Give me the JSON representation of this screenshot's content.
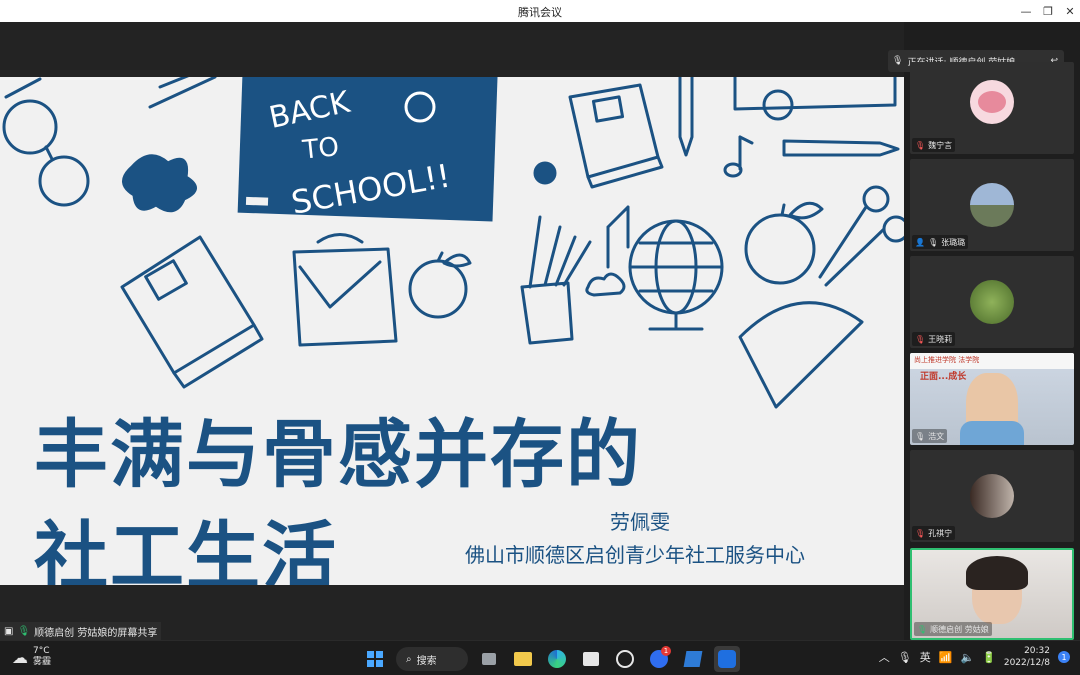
{
  "window": {
    "title": "腾讯会议"
  },
  "slide": {
    "chalkboard_text": "BACK TO SCHOOL!!",
    "title_line1": "丰满与骨感并存的",
    "title_line2": "社工生活",
    "author": "劳佩雯",
    "organization": "佛山市顺德区启创青少年社工服务中心"
  },
  "share_label": "顺德启创 劳姑娘的屏幕共享",
  "speaking": "正在讲话: 顺德启创 劳姑娘",
  "participants": [
    {
      "name": "魏宁言",
      "avatar_color": "#f7d9df"
    },
    {
      "name": "张璐璐",
      "avatar_color": "#8ea7c7"
    },
    {
      "name": "王晓莉",
      "avatar_color": "#6c8a3a"
    },
    {
      "name": "浩文",
      "banner": "正面...成长",
      "banner2": "尚上推进学院 法学院"
    },
    {
      "name": "孔祺宁",
      "avatar_color": "#8a7d78"
    },
    {
      "name": "顺德启创 劳姑娘"
    }
  ],
  "taskbar": {
    "weather_temp": "7°C",
    "weather_desc": "雾霾",
    "search_label": "搜索",
    "ime": "英",
    "time": "20:32",
    "date": "2022/12/8",
    "notification_count": "1",
    "store_badge": "1"
  },
  "colors": {
    "accent_blue": "#1b5283",
    "active_border": "#2fbf71"
  }
}
